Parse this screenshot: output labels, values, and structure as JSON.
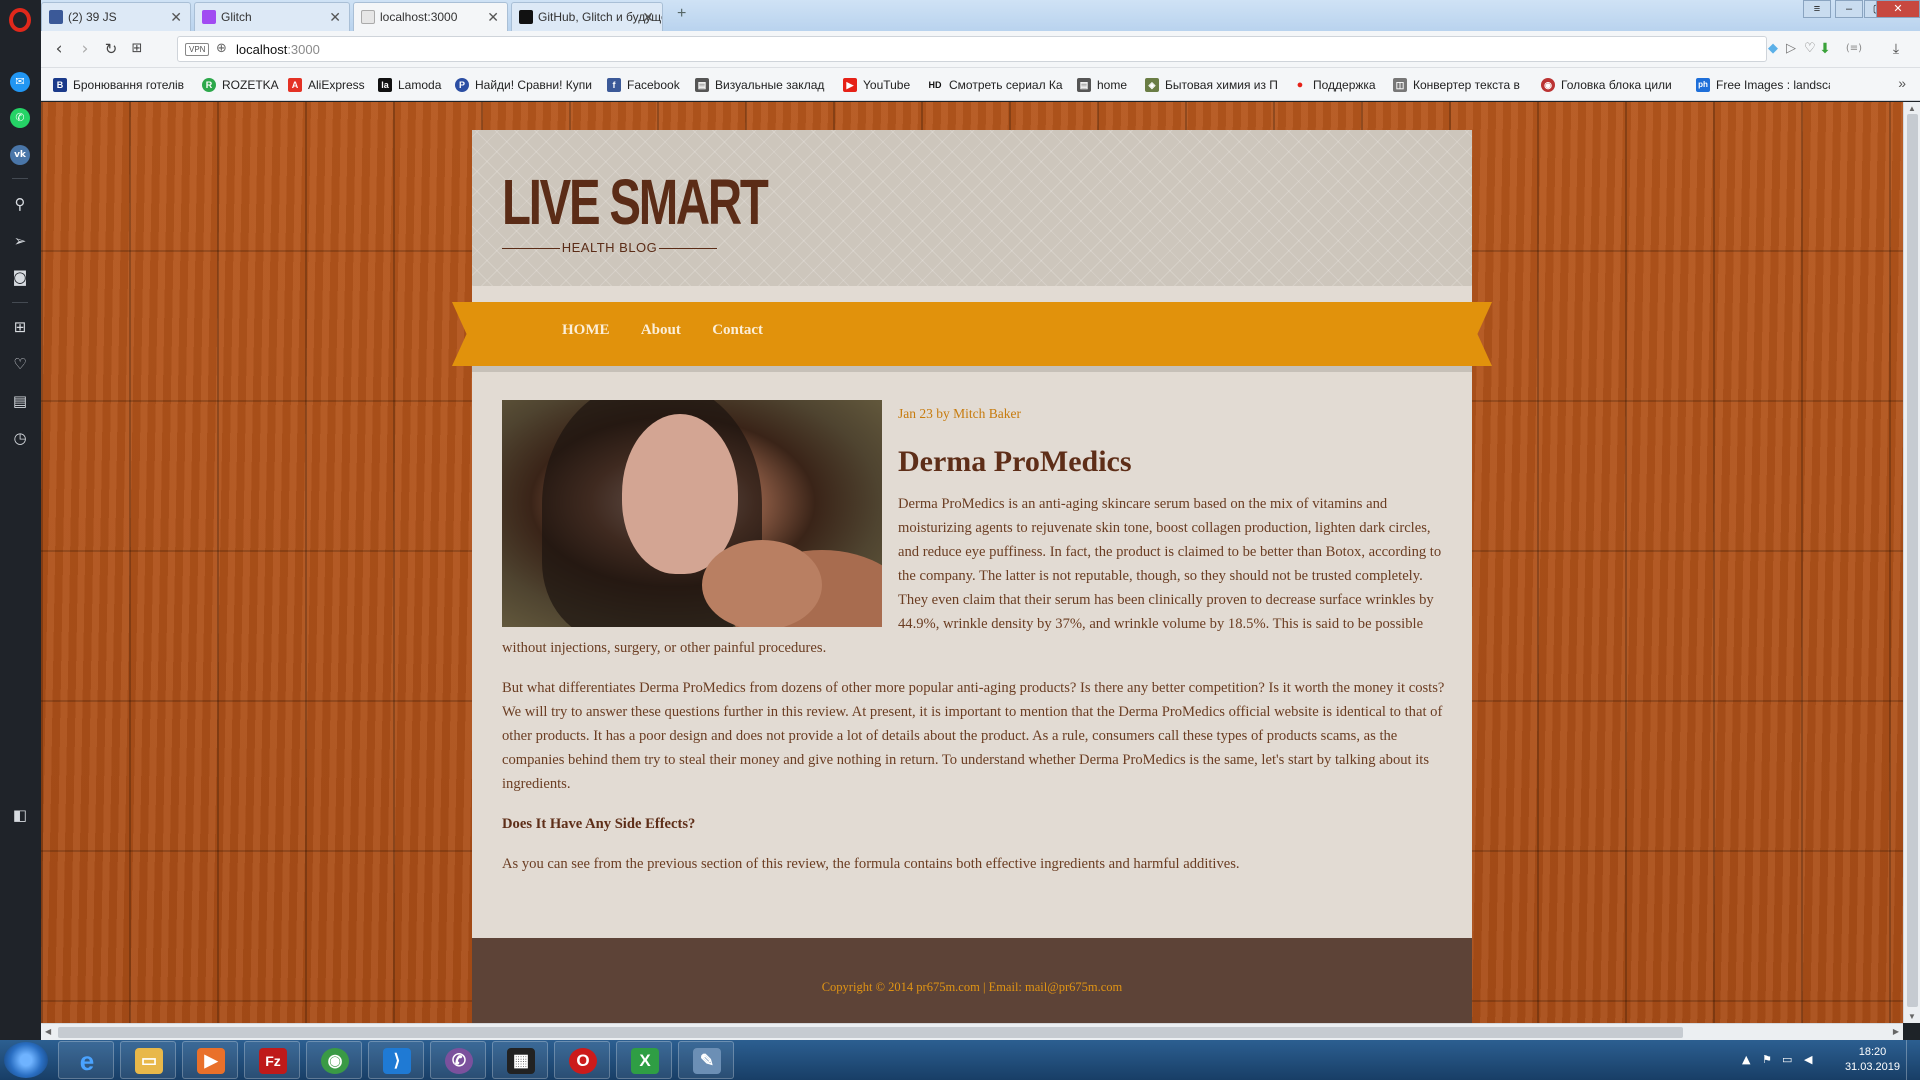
{
  "browser": {
    "tabs": [
      {
        "label": "(2) 39 JS",
        "icon": "facebook-icon",
        "color": "#3b5998"
      },
      {
        "label": "Glitch",
        "icon": "glitch-icon",
        "color": "#a14bf2"
      },
      {
        "label": "localhost:3000",
        "icon": "page-icon",
        "color": "#cccccc"
      },
      {
        "label": "GitHub, Glitch и будущее",
        "icon": "medium-icon",
        "color": "#111111"
      }
    ],
    "url_host": "localhost",
    "url_port": ":3000",
    "vpn_label": "VPN",
    "bookmarks": [
      {
        "label": "Бронювання готелів",
        "icon": "B",
        "color": "#1b3a8a"
      },
      {
        "label": "ROZETKA",
        "icon": "R",
        "color": "#2ca84b"
      },
      {
        "label": "AliExpress",
        "icon": "A",
        "color": "#e43225"
      },
      {
        "label": "Lamoda",
        "icon": "la",
        "color": "#111111"
      },
      {
        "label": "Найди! Сравни! Купи",
        "icon": "P",
        "color": "#2b4ea3"
      },
      {
        "label": "Facebook",
        "icon": "f",
        "color": "#3b5998"
      },
      {
        "label": "Визуальные заклад",
        "icon": "▤",
        "color": "#555555"
      },
      {
        "label": "YouTube",
        "icon": "▶",
        "color": "#e62117"
      },
      {
        "label": "Смотреть сериал Ка",
        "icon": "HD",
        "color": "#222222"
      },
      {
        "label": "home",
        "icon": "▤",
        "color": "#555555"
      },
      {
        "label": "Бытовая химия из П",
        "icon": "◈",
        "color": "#6a7d45"
      },
      {
        "label": "Поддержка",
        "icon": "●",
        "color": "#e62117"
      },
      {
        "label": "Конвертер текста в",
        "icon": "◫",
        "color": "#777777"
      },
      {
        "label": "Головка блока цили",
        "icon": "◉",
        "color": "#b33"
      },
      {
        "label": "Free Images : landsca",
        "icon": "ph",
        "color": "#1e6fd9"
      }
    ]
  },
  "site": {
    "logo_main": "LIVE SMART",
    "logo_sub": "HEALTH BLOG",
    "nav": [
      "HOME",
      "About",
      "Contact"
    ],
    "article": {
      "meta": "Jan 23 by Mitch Baker",
      "title": "Derma ProMedics",
      "p1": "Derma ProMedics is an anti-aging skincare serum based on the mix of vitamins and moisturizing agents to rejuvenate skin tone, boost collagen production, lighten dark circles, and reduce eye puffiness. In fact, the product is claimed to be better than Botox, according to the company. The latter is not reputable, though, so they should not be trusted completely. They even claim that their serum has been clinically proven to decrease surface wrinkles by 44.9%, wrinkle density by 37%, and wrinkle volume by 18.5%. This is said to be possible without injections, surgery, or other painful procedures.",
      "p2": "But what differentiates Derma ProMedics from dozens of other more popular anti-aging products? Is there any better competition? Is it worth the money it costs? We will try to answer these questions further in this review. At present, it is important to mention that the Derma ProMedics official website is identical to that of other products. It has a poor design and does not provide a lot of details about the product. As a rule, consumers call these types of products scams, as the companies behind them try to steal their money and give nothing in return. To understand whether Derma ProMedics is the same, let's start by talking about its ingredients.",
      "h4": "Does It Have Any Side Effects?",
      "p3": "As you can see from the previous section of this review, the formula contains both effective ingredients and harmful additives."
    },
    "footer": "Copyright © 2014 pr675m.com | Email: mail@pr675m.com"
  },
  "taskbar": {
    "apps": [
      {
        "icon": "internet-explorer-icon",
        "glyph": "e",
        "color": "#1e88e5"
      },
      {
        "icon": "file-explorer-icon",
        "glyph": "▭",
        "color": "#e8b84a"
      },
      {
        "icon": "media-player-icon",
        "glyph": "▶",
        "color": "#e9702a"
      },
      {
        "icon": "filezilla-icon",
        "glyph": "Fz",
        "color": "#bf1a1a"
      },
      {
        "icon": "chrome-icon",
        "glyph": "◉",
        "color": "#3a9a45"
      },
      {
        "icon": "vscode-icon",
        "glyph": "⟩",
        "color": "#1f7ad4"
      },
      {
        "icon": "viber-icon",
        "glyph": "✆",
        "color": "#7b519d"
      },
      {
        "icon": "film-icon",
        "glyph": "▦",
        "color": "#222222"
      },
      {
        "icon": "opera-icon",
        "glyph": "O",
        "color": "#cc1b1b"
      },
      {
        "icon": "xmind-icon",
        "glyph": "X",
        "color": "#2f9e44"
      },
      {
        "icon": "paint-icon",
        "glyph": "✎",
        "color": "#6c8fb5"
      }
    ],
    "time": "18:20",
    "date": "31.03.2019"
  }
}
